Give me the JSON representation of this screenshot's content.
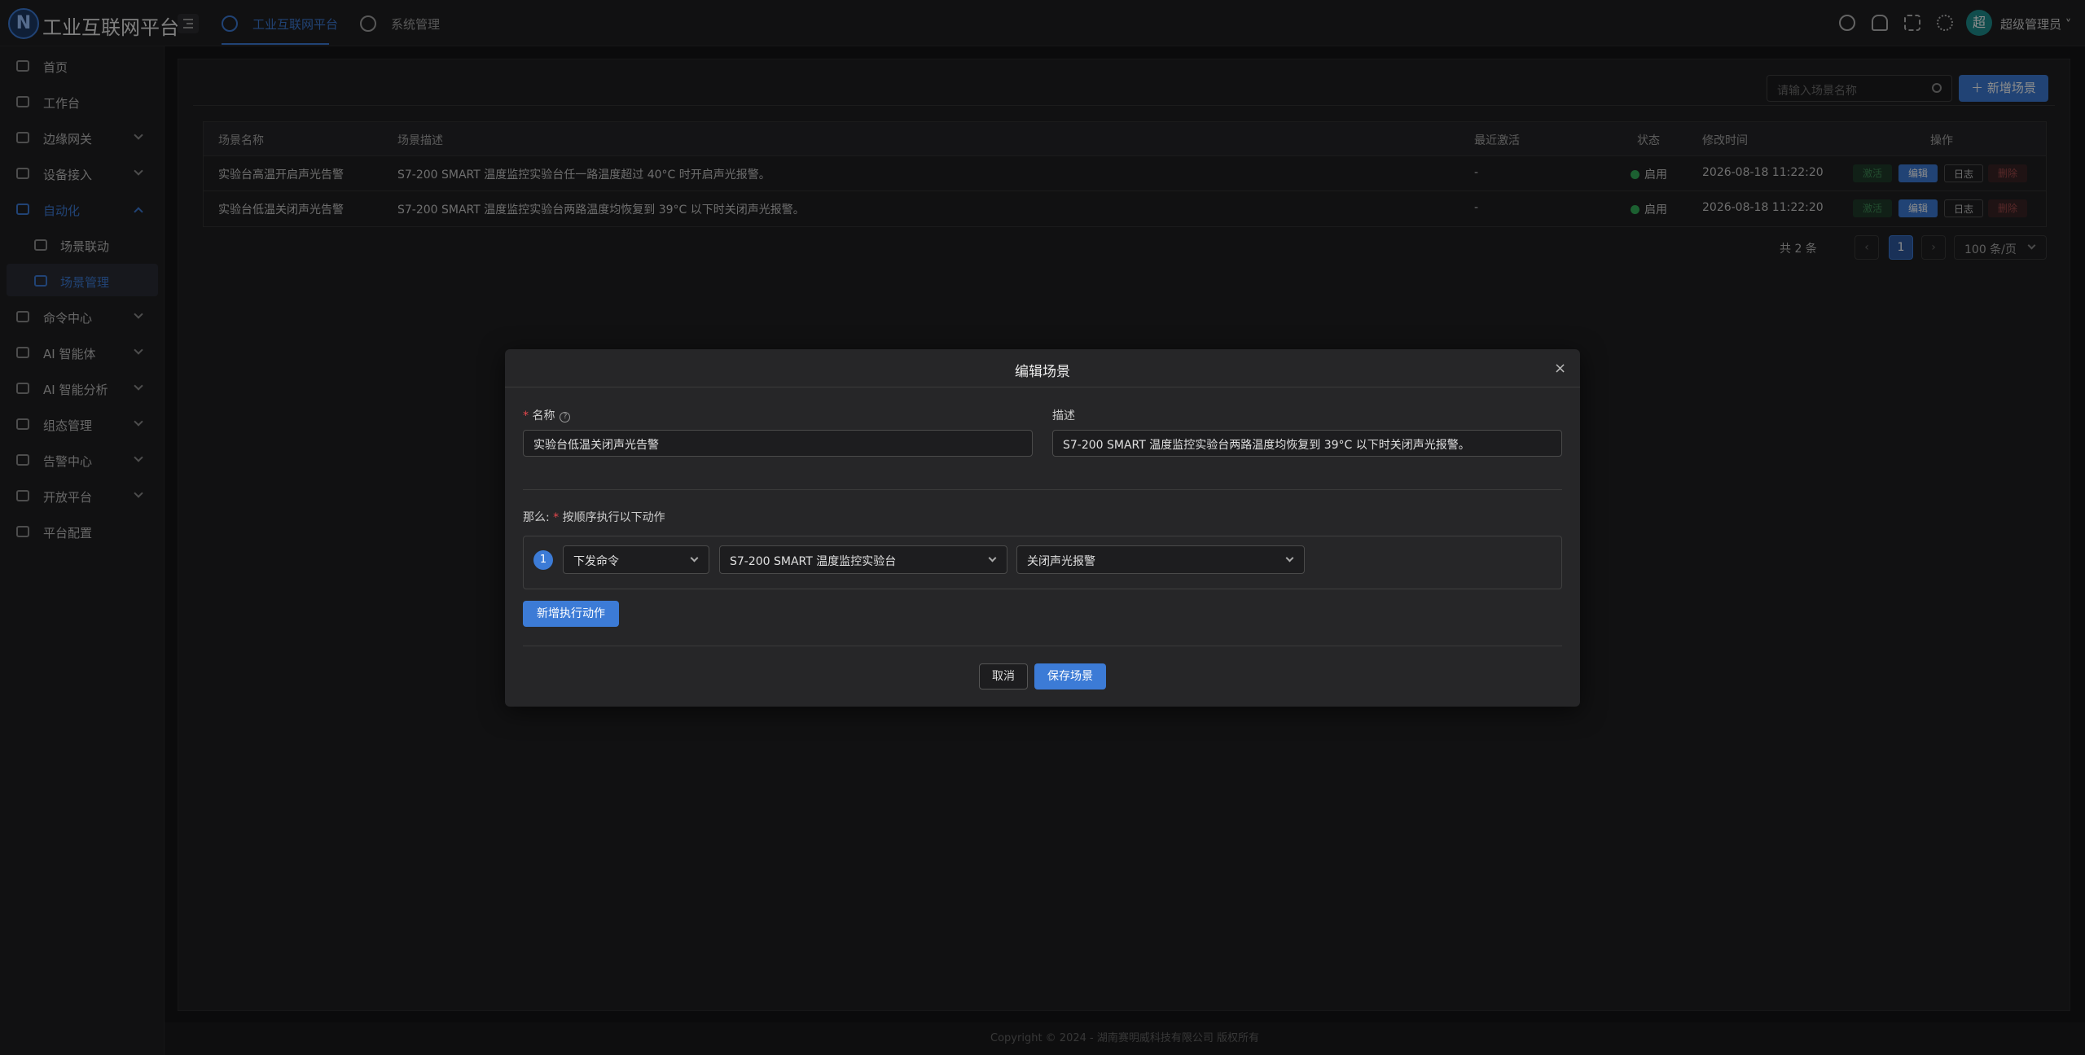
{
  "header": {
    "logo_letter": "N",
    "app_title": "工业互联网平台",
    "tabs": [
      {
        "label": "工业互联网平台",
        "active": true
      },
      {
        "label": "系统管理",
        "active": false
      }
    ],
    "icons": [
      "settings-icon",
      "bell-icon",
      "fullscreen-icon",
      "theme-icon"
    ],
    "avatar_text": "超",
    "user_name": "超级管理员"
  },
  "sidebar": {
    "items": [
      {
        "label": "首页",
        "icon": "monitor-icon"
      },
      {
        "label": "工作台",
        "icon": "dashboard-icon"
      },
      {
        "label": "边缘网关",
        "icon": "gateway-icon",
        "expandable": true
      },
      {
        "label": "设备接入",
        "icon": "device-icon",
        "expandable": true
      },
      {
        "label": "自动化",
        "icon": "automation-icon",
        "expandable": true,
        "open": true
      },
      {
        "label": "场景联动",
        "icon": "branch-icon",
        "sub": true
      },
      {
        "label": "场景管理",
        "icon": "grid-icon",
        "sub": true,
        "selected": true
      },
      {
        "label": "命令中心",
        "icon": "command-icon",
        "expandable": true
      },
      {
        "label": "AI 智能体",
        "icon": "robot-icon",
        "expandable": true
      },
      {
        "label": "AI 智能分析",
        "icon": "chart-icon",
        "expandable": true
      },
      {
        "label": "组态管理",
        "icon": "layout-icon",
        "expandable": true
      },
      {
        "label": "告警中心",
        "icon": "alarm-icon",
        "expandable": true
      },
      {
        "label": "开放平台",
        "icon": "api-icon",
        "expandable": true
      },
      {
        "label": "平台配置",
        "icon": "sliders-icon"
      }
    ]
  },
  "toolbar": {
    "search_placeholder": "请输入场景名称",
    "add_button": "新增场景"
  },
  "table": {
    "columns": [
      "场景名称",
      "场景描述",
      "最近激活",
      "状态",
      "修改时间",
      "操作"
    ],
    "rows": [
      {
        "name": "实验台高温开启声光告警",
        "desc": "S7-200 SMART 温度监控实验台任一路温度超过 40°C 时开启声光报警。",
        "last_active": "-",
        "status": "启用",
        "modified": "2026-08-18 11:22:20"
      },
      {
        "name": "实验台低温关闭声光告警",
        "desc": "S7-200 SMART 温度监控实验台两路温度均恢复到 39°C 以下时关闭声光报警。",
        "last_active": "-",
        "status": "启用",
        "modified": "2026-08-18 11:22:20"
      }
    ],
    "op_labels": {
      "activate": "激活",
      "edit": "编辑",
      "log": "日志",
      "delete": "删除"
    }
  },
  "pagination": {
    "total_text": "共 2 条",
    "prev": "‹",
    "current": "1",
    "next": "›",
    "page_size": "100 条/页"
  },
  "footer": {
    "text": "Copyright © 2024 - 湖南赛明威科技有限公司 版权所有"
  },
  "modal": {
    "title": "编辑场景",
    "close": "×",
    "name_label": "名称",
    "name_value": "实验台低温关闭声光告警",
    "desc_label": "描述",
    "desc_value": "S7-200 SMART 温度监控实验台两路温度均恢复到 39°C 以下时关闭声光报警。",
    "then_label": "那么:",
    "then_hint": "按顺序执行以下动作",
    "action": {
      "index": "1",
      "type": "下发命令",
      "device": "S7-200 SMART 温度监控实验台",
      "command": "关闭声光报警"
    },
    "add_action": "新增执行动作",
    "cancel": "取消",
    "save": "保存场景"
  },
  "colors": {
    "accent": "#3c7bd6",
    "success": "#33b05a",
    "danger": "#e5484d"
  }
}
